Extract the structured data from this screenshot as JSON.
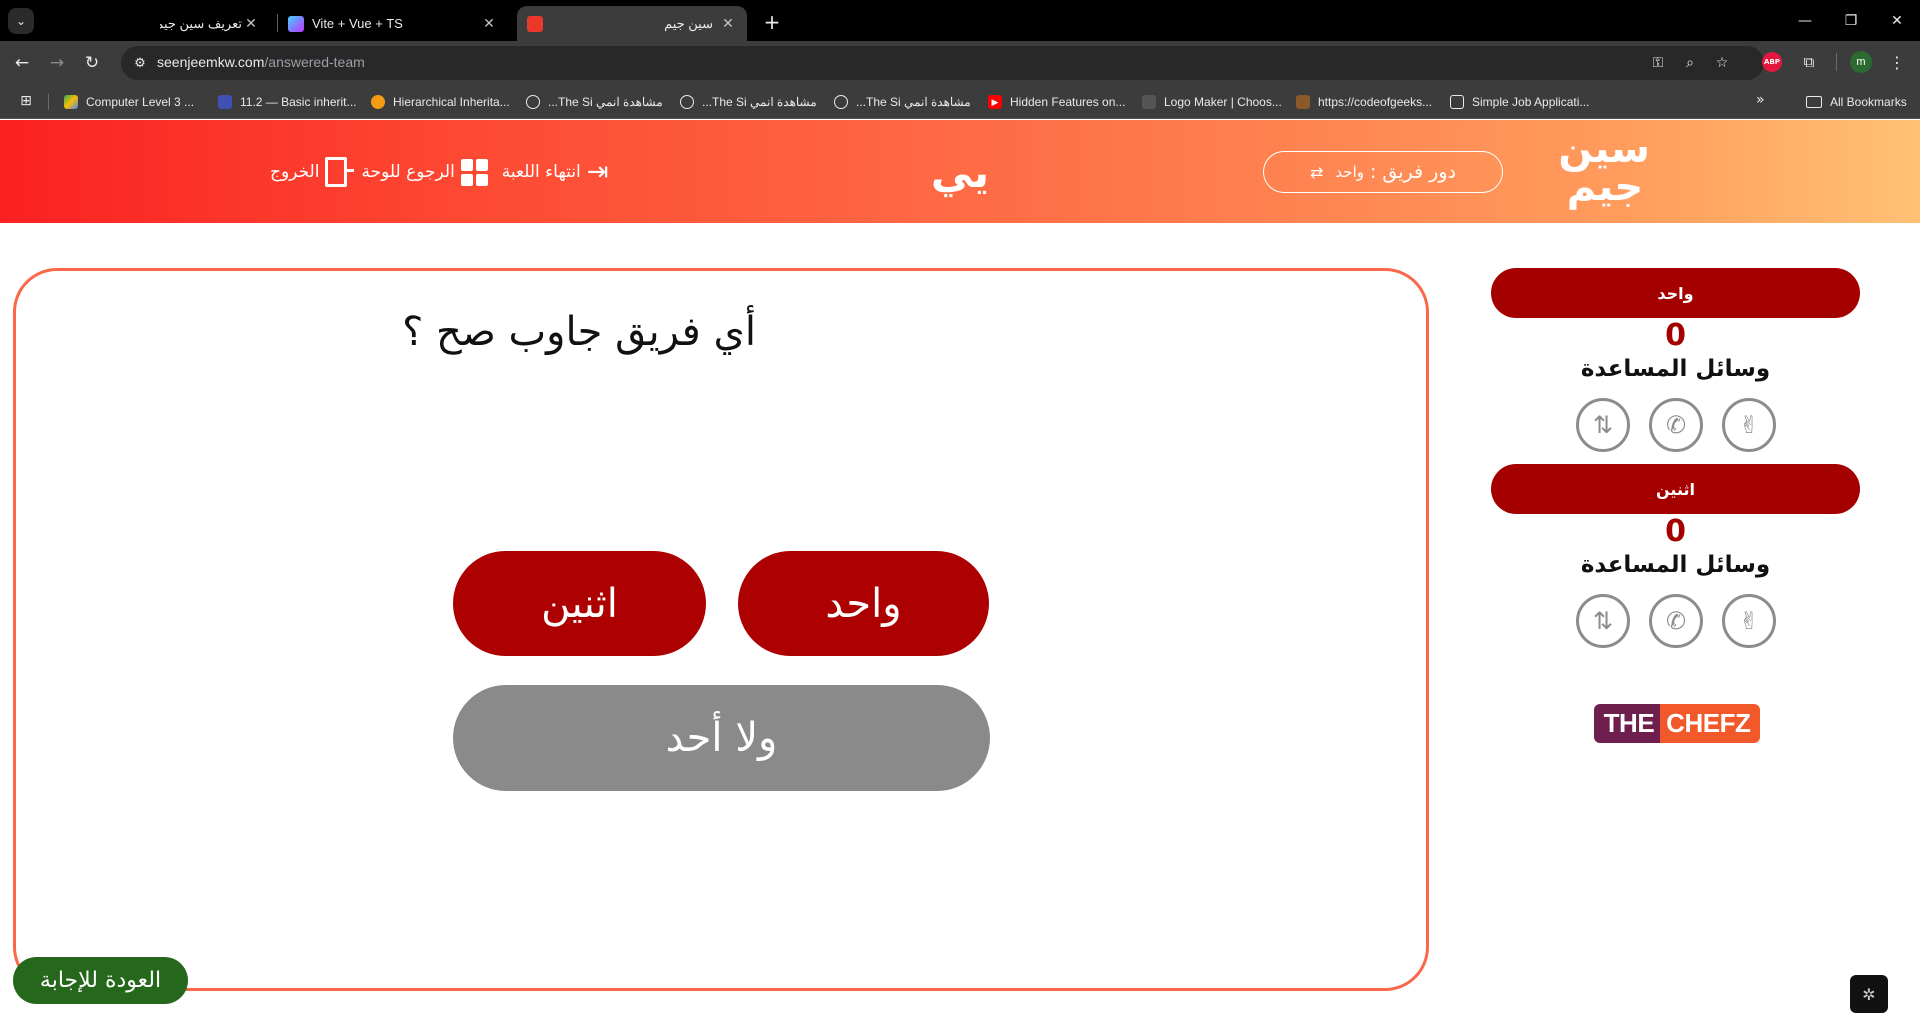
{
  "browser": {
    "tabs": [
      {
        "title": "تعريف سين جيم",
        "active": false
      },
      {
        "title": "Vite + Vue + TS",
        "active": false
      },
      {
        "title": "سين جيم",
        "active": true
      }
    ],
    "url_host": "seenjeemkw.com",
    "url_path": "/answered-team",
    "bookmarks": [
      {
        "label": "Computer Level 3 ..."
      },
      {
        "label": "11.2 — Basic inherit..."
      },
      {
        "label": "Hierarchical Inherita..."
      },
      {
        "label": "مشاهدة انمي The Si..."
      },
      {
        "label": "مشاهدة انمي The Si..."
      },
      {
        "label": "مشاهدة انمي The Si..."
      },
      {
        "label": "Hidden Features on..."
      },
      {
        "label": "Logo Maker | Choos..."
      },
      {
        "label": "https://codeofgeeks..."
      },
      {
        "label": "Simple Job Applicati..."
      }
    ],
    "all_bookmarks": "All Bookmarks",
    "profile_initial": "m",
    "abp_label": "ABP"
  },
  "header": {
    "logo_line1": "سين",
    "logo_line2": "جيم",
    "turn_label": "دور فريق :",
    "turn_team": "واحد",
    "game_name": "يي",
    "end_game": "انتهاء اللعبة",
    "back_to_board": "الرجوع للوحة",
    "exit": "الخروج"
  },
  "question": {
    "text": "أي فريق جاوب صح ؟",
    "answers": {
      "one": "واحد",
      "two": "اثنين",
      "none": "ولا أحد"
    }
  },
  "back_to_answer": "العودة للإجابة",
  "teams": [
    {
      "name": "واحد",
      "score": "0",
      "aids_label": "وسائل المساعدة"
    },
    {
      "name": "اثنين",
      "score": "0",
      "aids_label": "وسائل المساعدة"
    }
  ],
  "sponsor": {
    "part1": "THE",
    "part2": "CHEFZ"
  },
  "colors": {
    "header_gradient_start": "#fb2121",
    "header_gradient_end": "#ffc175",
    "team_red": "#a50000",
    "answer_red": "#ad0000",
    "answer_gray": "#8a8a8a",
    "panel_border": "#fa6749",
    "back_button_green": "#25681c"
  },
  "icons": {
    "lifelines": [
      "two-answers-hand-icon",
      "phone-call-icon",
      "swap-question-icon"
    ]
  }
}
